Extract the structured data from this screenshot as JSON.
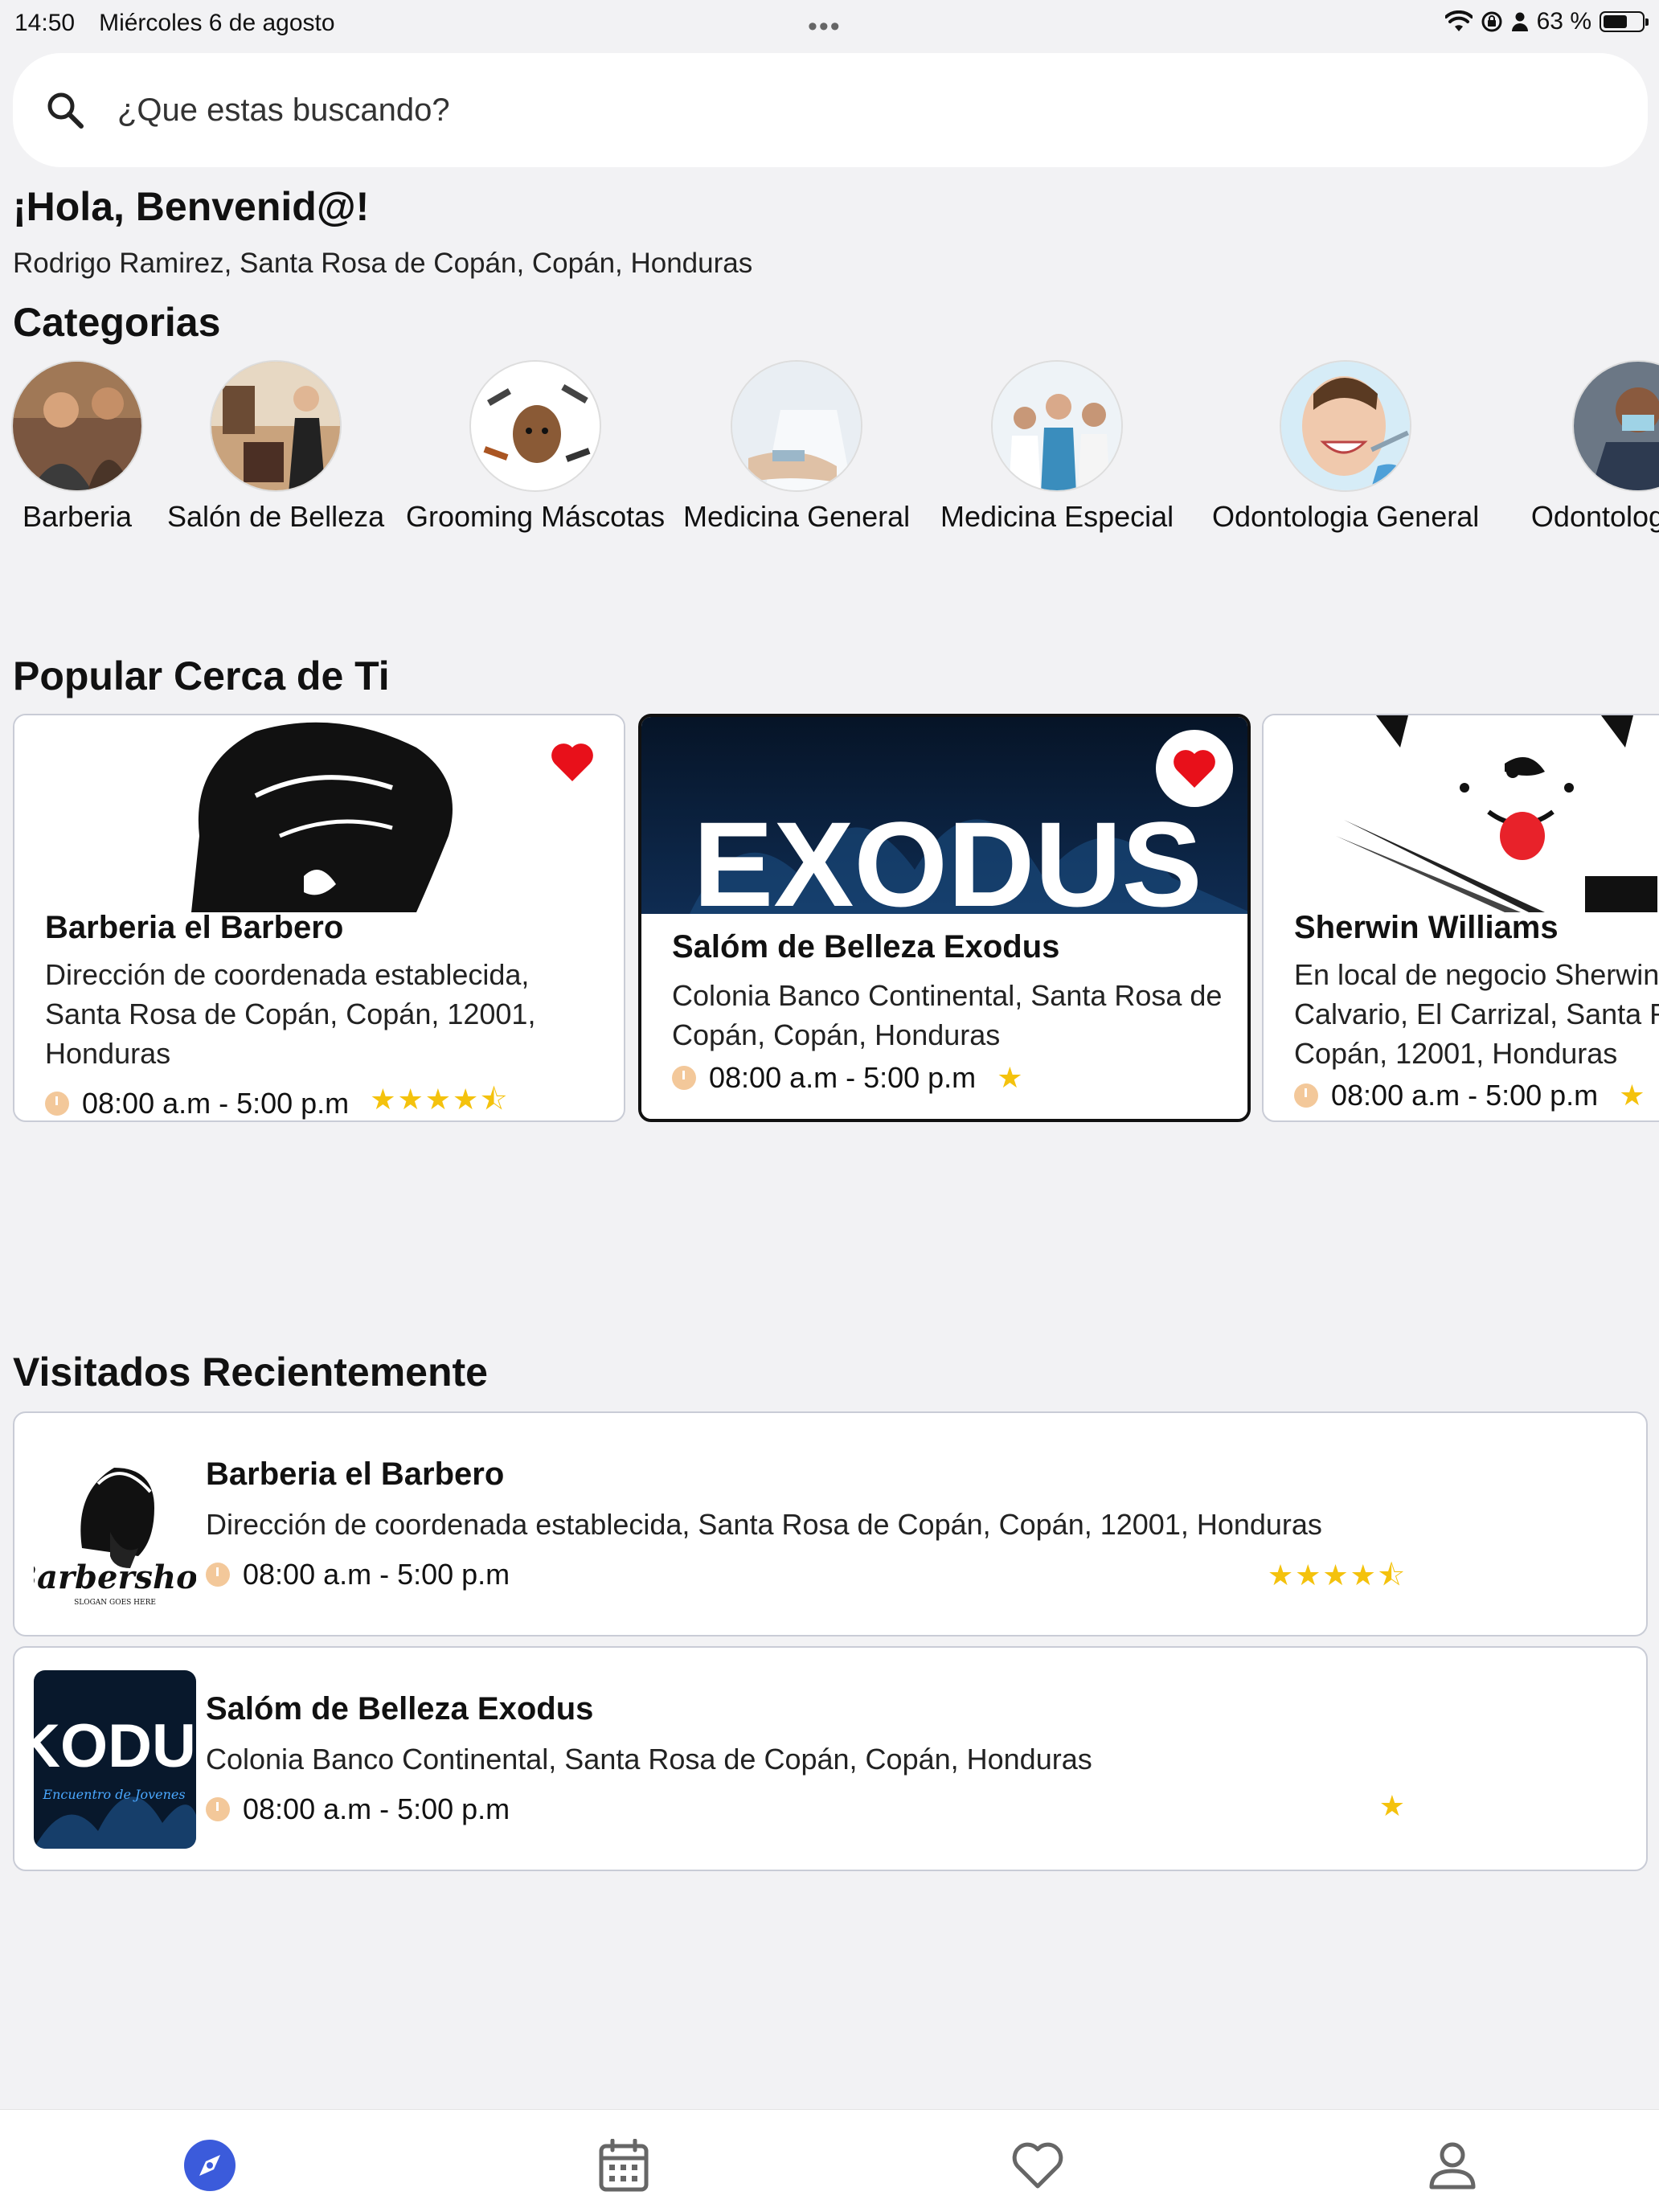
{
  "status_bar": {
    "time": "14:50",
    "date": "Miércoles 6 de agosto",
    "dots": "•••",
    "battery": "63 %"
  },
  "search": {
    "placeholder": "¿Que estas buscando?"
  },
  "greeting": {
    "title": "¡Hola, Benvenid@!",
    "location": "Rodrigo Ramirez, Santa Rosa de Copán, Copán, Honduras"
  },
  "categories": {
    "heading": "Categorias",
    "items": [
      {
        "label": "Barberia"
      },
      {
        "label": "Salón de Belleza"
      },
      {
        "label": "Grooming Máscotas"
      },
      {
        "label": "Medicina General"
      },
      {
        "label": "Medicina Especial"
      },
      {
        "label": "Odontologia General"
      },
      {
        "label": "Odontologí"
      }
    ]
  },
  "popular": {
    "heading": "Popular Cerca de Ti",
    "cards": [
      {
        "title": "Barberia el Barbero",
        "address": "Dirección de coordenada establecida, Santa Rosa de Copán, Copán, 12001, Honduras",
        "hours": "08:00 a.m - 5:00 p.m",
        "stars": "★★★★⯪",
        "rating": 4.5,
        "favorite": true
      },
      {
        "title": "Salóm de Belleza Exodus",
        "address": "Colonia Banco Continental, Santa Rosa de Copán, Copán, Honduras",
        "hours": "08:00 a.m - 5:00 p.m",
        "stars": "★",
        "rating": 1,
        "favorite": true,
        "image_text": "EXODUS"
      },
      {
        "title": "Sherwin Williams",
        "address": "En local de negocio Sherwin Williams, El Calvario, El Carrizal, Santa Rosa de Copán, Copán, 12001, Honduras",
        "hours": "08:00 a.m - 5:00 p.m",
        "stars": "★",
        "rating": 1
      }
    ]
  },
  "recent": {
    "heading": "Visitados Recientemente",
    "items": [
      {
        "title": "Barberia el Barbero",
        "address": "Dirección de coordenada establecida, Santa Rosa de Copán, Copán, 12001, Honduras",
        "hours": "08:00 a.m - 5:00 p.m",
        "stars": "★★★★⯪",
        "rating": 4.5,
        "logo_text": "Barbershop",
        "logo_sub": "SLOGAN GOES HERE"
      },
      {
        "title": "Salóm de Belleza Exodus",
        "address": "Colonia Banco Continental, Santa Rosa de Copán, Copán, Honduras",
        "hours": "08:00 a.m - 5:00 p.m",
        "stars": "★",
        "rating": 1,
        "logo_text": "KODU",
        "logo_sub": "Encuentro de Jovenes"
      }
    ]
  },
  "nav": {
    "items": [
      "explore-icon",
      "calendar-icon",
      "heart-icon",
      "profile-icon"
    ],
    "active_color": "#3b5bdb"
  },
  "colors": {
    "star": "#f4c20d",
    "heart": "#e8101a",
    "clock": "#f3c89a"
  }
}
